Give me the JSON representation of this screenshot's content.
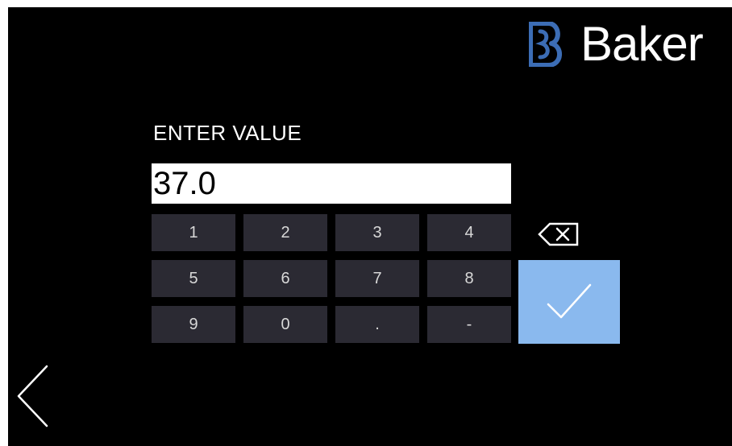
{
  "brand": {
    "name": "Baker",
    "logo_icon": "baker-b-logo-icon",
    "logo_color": "#3c6db5"
  },
  "prompt_label": "ENTER VALUE",
  "value_field": {
    "value": "37.0"
  },
  "keypad": {
    "keys": [
      "1",
      "2",
      "3",
      "4",
      "5",
      "6",
      "7",
      "8",
      "9",
      "0",
      ".",
      "-"
    ]
  },
  "icons": {
    "backspace": "backspace-icon",
    "confirm": "checkmark-icon",
    "back": "chevron-left-icon"
  },
  "colors": {
    "screen_background": "#000000",
    "key_background": "#2b2a33",
    "confirm_background": "#8ab9ee",
    "field_background": "#ffffff"
  }
}
